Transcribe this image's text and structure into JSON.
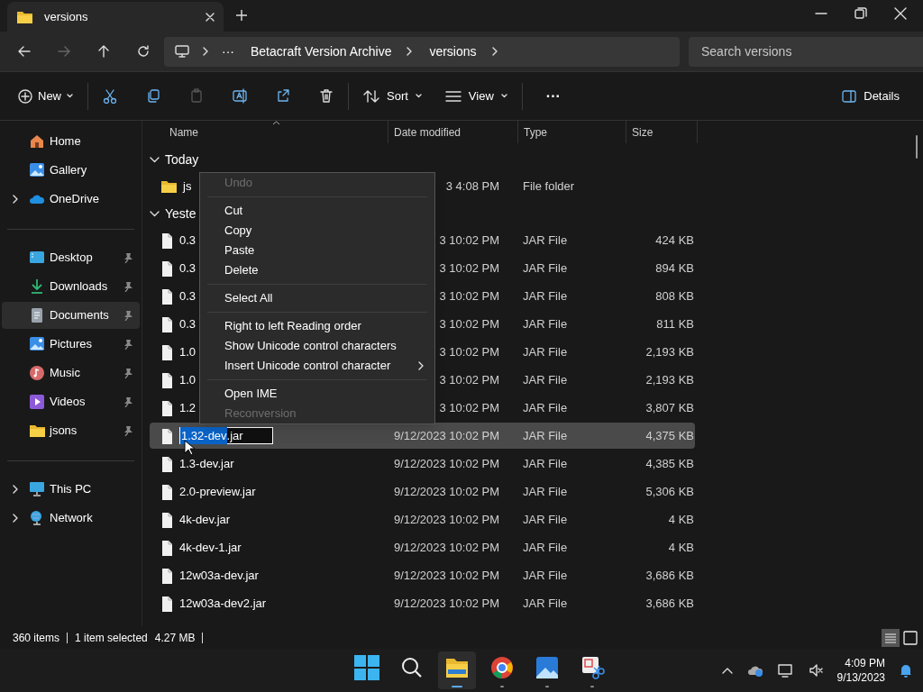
{
  "tab": {
    "title": "versions"
  },
  "address": {
    "crumbs": [
      "Betacraft Version Archive",
      "versions"
    ],
    "overflow": "···"
  },
  "search": {
    "placeholder": "Search versions"
  },
  "toolbar": {
    "new": "New",
    "sort": "Sort",
    "view": "View",
    "more": "···",
    "details": "Details"
  },
  "sidebar": {
    "groups": [
      [
        {
          "label": "Home",
          "expandable": false,
          "selected": false,
          "pinned": false
        },
        {
          "label": "Gallery",
          "expandable": false,
          "selected": false,
          "pinned": false
        },
        {
          "label": "OneDrive",
          "expandable": true,
          "selected": false,
          "pinned": false
        }
      ],
      [
        {
          "label": "Desktop",
          "expandable": false,
          "selected": false,
          "pinned": true
        },
        {
          "label": "Downloads",
          "expandable": false,
          "selected": false,
          "pinned": true
        },
        {
          "label": "Documents",
          "expandable": false,
          "selected": true,
          "pinned": true
        },
        {
          "label": "Pictures",
          "expandable": false,
          "selected": false,
          "pinned": true
        },
        {
          "label": "Music",
          "expandable": false,
          "selected": false,
          "pinned": true
        },
        {
          "label": "Videos",
          "expandable": false,
          "selected": false,
          "pinned": true
        },
        {
          "label": "jsons",
          "expandable": false,
          "selected": false,
          "pinned": true
        }
      ],
      [
        {
          "label": "This PC",
          "expandable": true,
          "selected": false,
          "pinned": false
        },
        {
          "label": "Network",
          "expandable": true,
          "selected": false,
          "pinned": false
        }
      ]
    ]
  },
  "columns": [
    "Name",
    "Date modified",
    "Type",
    "Size"
  ],
  "groups": [
    {
      "title": "Today",
      "rows": [
        {
          "kind": "folder",
          "name": "js",
          "date": "3 4:08 PM",
          "type": "File folder",
          "size": ""
        }
      ]
    },
    {
      "title": "Yeste",
      "rows": [
        {
          "kind": "file",
          "name": "0.3",
          "date": "3 10:02 PM",
          "type": "JAR File",
          "size": "424 KB"
        },
        {
          "kind": "file",
          "name": "0.3",
          "date": "3 10:02 PM",
          "type": "JAR File",
          "size": "894 KB"
        },
        {
          "kind": "file",
          "name": "0.3",
          "date": "3 10:02 PM",
          "type": "JAR File",
          "size": "808 KB"
        },
        {
          "kind": "file",
          "name": "0.3",
          "date": "3 10:02 PM",
          "type": "JAR File",
          "size": "811 KB"
        },
        {
          "kind": "file",
          "name": "1.0",
          "date": "3 10:02 PM",
          "type": "JAR File",
          "size": "2,193 KB"
        },
        {
          "kind": "file",
          "name": "1.0",
          "date": "3 10:02 PM",
          "type": "JAR File",
          "size": "2,193 KB"
        },
        {
          "kind": "file",
          "name": "1.2",
          "date": "3 10:02 PM",
          "type": "JAR File",
          "size": "3,807 KB"
        },
        {
          "kind": "rename",
          "name": "1.32-dev",
          "name_rest": ".jar",
          "date": "9/12/2023 10:02 PM",
          "type": "JAR File",
          "size": "4,375 KB"
        },
        {
          "kind": "file",
          "name": "1.3-dev.jar",
          "date": "9/12/2023 10:02 PM",
          "type": "JAR File",
          "size": "4,385 KB"
        },
        {
          "kind": "file",
          "name": "2.0-preview.jar",
          "date": "9/12/2023 10:02 PM",
          "type": "JAR File",
          "size": "5,306 KB"
        },
        {
          "kind": "file",
          "name": "4k-dev.jar",
          "date": "9/12/2023 10:02 PM",
          "type": "JAR File",
          "size": "4 KB"
        },
        {
          "kind": "file",
          "name": "4k-dev-1.jar",
          "date": "9/12/2023 10:02 PM",
          "type": "JAR File",
          "size": "4 KB"
        },
        {
          "kind": "file",
          "name": "12w03a-dev.jar",
          "date": "9/12/2023 10:02 PM",
          "type": "JAR File",
          "size": "3,686 KB"
        },
        {
          "kind": "file",
          "name": "12w03a-dev2.jar",
          "date": "9/12/2023 10:02 PM",
          "type": "JAR File",
          "size": "3,686 KB"
        }
      ]
    }
  ],
  "context_menu": [
    [
      {
        "label": "Undo",
        "disabled": true,
        "submenu": false
      }
    ],
    [
      {
        "label": "Cut",
        "disabled": false,
        "submenu": false
      },
      {
        "label": "Copy",
        "disabled": false,
        "submenu": false
      },
      {
        "label": "Paste",
        "disabled": false,
        "submenu": false
      },
      {
        "label": "Delete",
        "disabled": false,
        "submenu": false
      }
    ],
    [
      {
        "label": "Select All",
        "disabled": false,
        "submenu": false
      }
    ],
    [
      {
        "label": "Right to left Reading order",
        "disabled": false,
        "submenu": false
      },
      {
        "label": "Show Unicode control characters",
        "disabled": false,
        "submenu": false
      },
      {
        "label": "Insert Unicode control character",
        "disabled": false,
        "submenu": true
      }
    ],
    [
      {
        "label": "Open IME",
        "disabled": false,
        "submenu": false
      },
      {
        "label": "Reconversion",
        "disabled": true,
        "submenu": false
      }
    ]
  ],
  "status_bar": {
    "items": "360 items",
    "selection": "1 item selected",
    "size": "4.27 MB"
  },
  "taskbar": {
    "time": "4:09 PM",
    "date": "9/13/2023"
  }
}
